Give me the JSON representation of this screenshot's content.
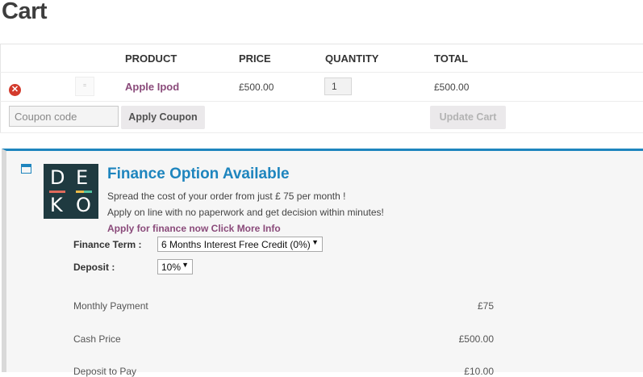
{
  "page": {
    "title": "Cart"
  },
  "cart": {
    "headers": {
      "product": "PRODUCT",
      "price": "PRICE",
      "quantity": "QUANTITY",
      "total": "TOTAL"
    },
    "item": {
      "thumb_alt": "=",
      "name": "Apple Ipod",
      "price": "£500.00",
      "quantity": "1",
      "total": "£500.00"
    },
    "coupon": {
      "placeholder": "Coupon code",
      "apply_label": "Apply Coupon"
    },
    "update_label": "Update Cart"
  },
  "finance": {
    "logo": {
      "letters": [
        "D",
        "E",
        "K",
        "O"
      ],
      "bar_colors": [
        "#e06a5b",
        "#e9b949",
        "#52c3a0"
      ]
    },
    "title": "Finance Option Available",
    "line1": "Spread the cost of your order from just £ 75 per month !",
    "line2": "Apply on line with no paperwork and get decision within minutes!",
    "link": "Apply for finance now Click More Info",
    "term_label": "Finance Term :",
    "term_value": "6 Months Interest Free Credit (0%)",
    "deposit_label": "Deposit :",
    "deposit_value": "10%",
    "summary": [
      {
        "label": "Monthly Payment",
        "value": "£75"
      },
      {
        "label": "Cash Price",
        "value": "£500.00"
      },
      {
        "label": "Deposit to Pay",
        "value": "£10.00"
      }
    ]
  },
  "colors": {
    "accent_blue": "#1e85be",
    "link_purple": "#8a4a7a",
    "remove_red": "#d33a2c"
  }
}
